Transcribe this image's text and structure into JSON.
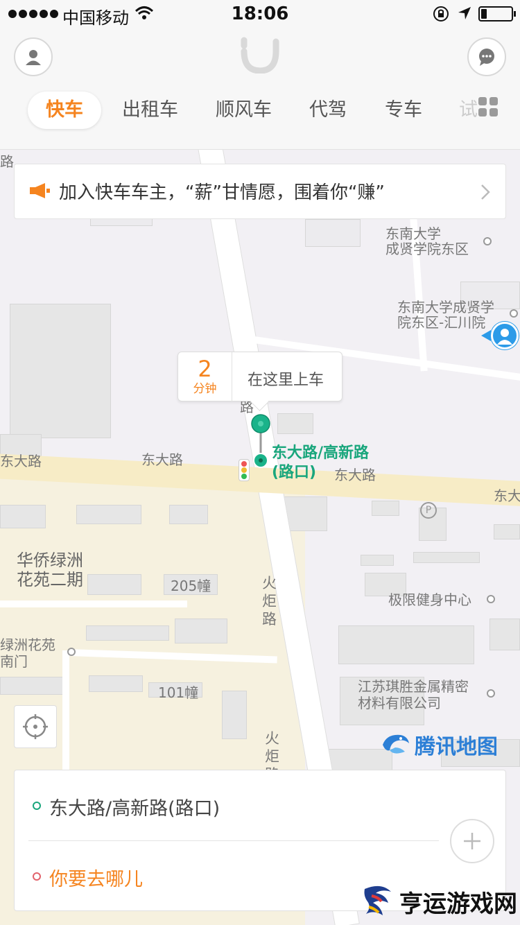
{
  "status_bar": {
    "carrier": "中国移动",
    "time": "18:06",
    "battery_level": 0.2
  },
  "header": {
    "tabs": [
      "快车",
      "出租车",
      "顺风车",
      "代驾",
      "专车",
      "试"
    ],
    "active_tab": "快车"
  },
  "promo": {
    "text": "加入快车车主，“薪”甘情愿，围着你“赚”"
  },
  "pickup_bubble": {
    "eta_value": "2",
    "eta_unit": "分钟",
    "label": "在这里上车"
  },
  "pin_label": {
    "line1": "东大路/高新路",
    "line2": "(路口)"
  },
  "map_labels": {
    "seu_east": "东南大学\n成贤学院东区",
    "seu_huichuan": "东南大学成贤学\n院东区-汇川院",
    "dongda_road_1": "东大路",
    "dongda_road_2": "东大路",
    "dongda_road_3": "东大路",
    "dongda_road_4": "东大",
    "road_top": "路",
    "road_left": "路",
    "huaqiao": "华侨绿洲\n花苑二期",
    "bldg_205": "205幢",
    "bldg_101": "101幢",
    "huoju_road_1": "火\n炬\n路",
    "huoju_road_2": "火\n炬\n路",
    "lvzhou_south": "绿洲花苑\n南门",
    "fitness": "极限健身中心",
    "jiangsu_qisheng": "江苏琪胜金属精密\n材料有限公司",
    "parking": "P"
  },
  "map_brand": "腾讯地图",
  "trip_card": {
    "from": "东大路/高新路(路口)",
    "to_placeholder": "你要去哪儿"
  },
  "watermark": "亨运游戏网",
  "colors": {
    "accent": "#f5841f",
    "green": "#19a67c",
    "red": "#e2626b",
    "map_brand": "#2c7fd6"
  }
}
